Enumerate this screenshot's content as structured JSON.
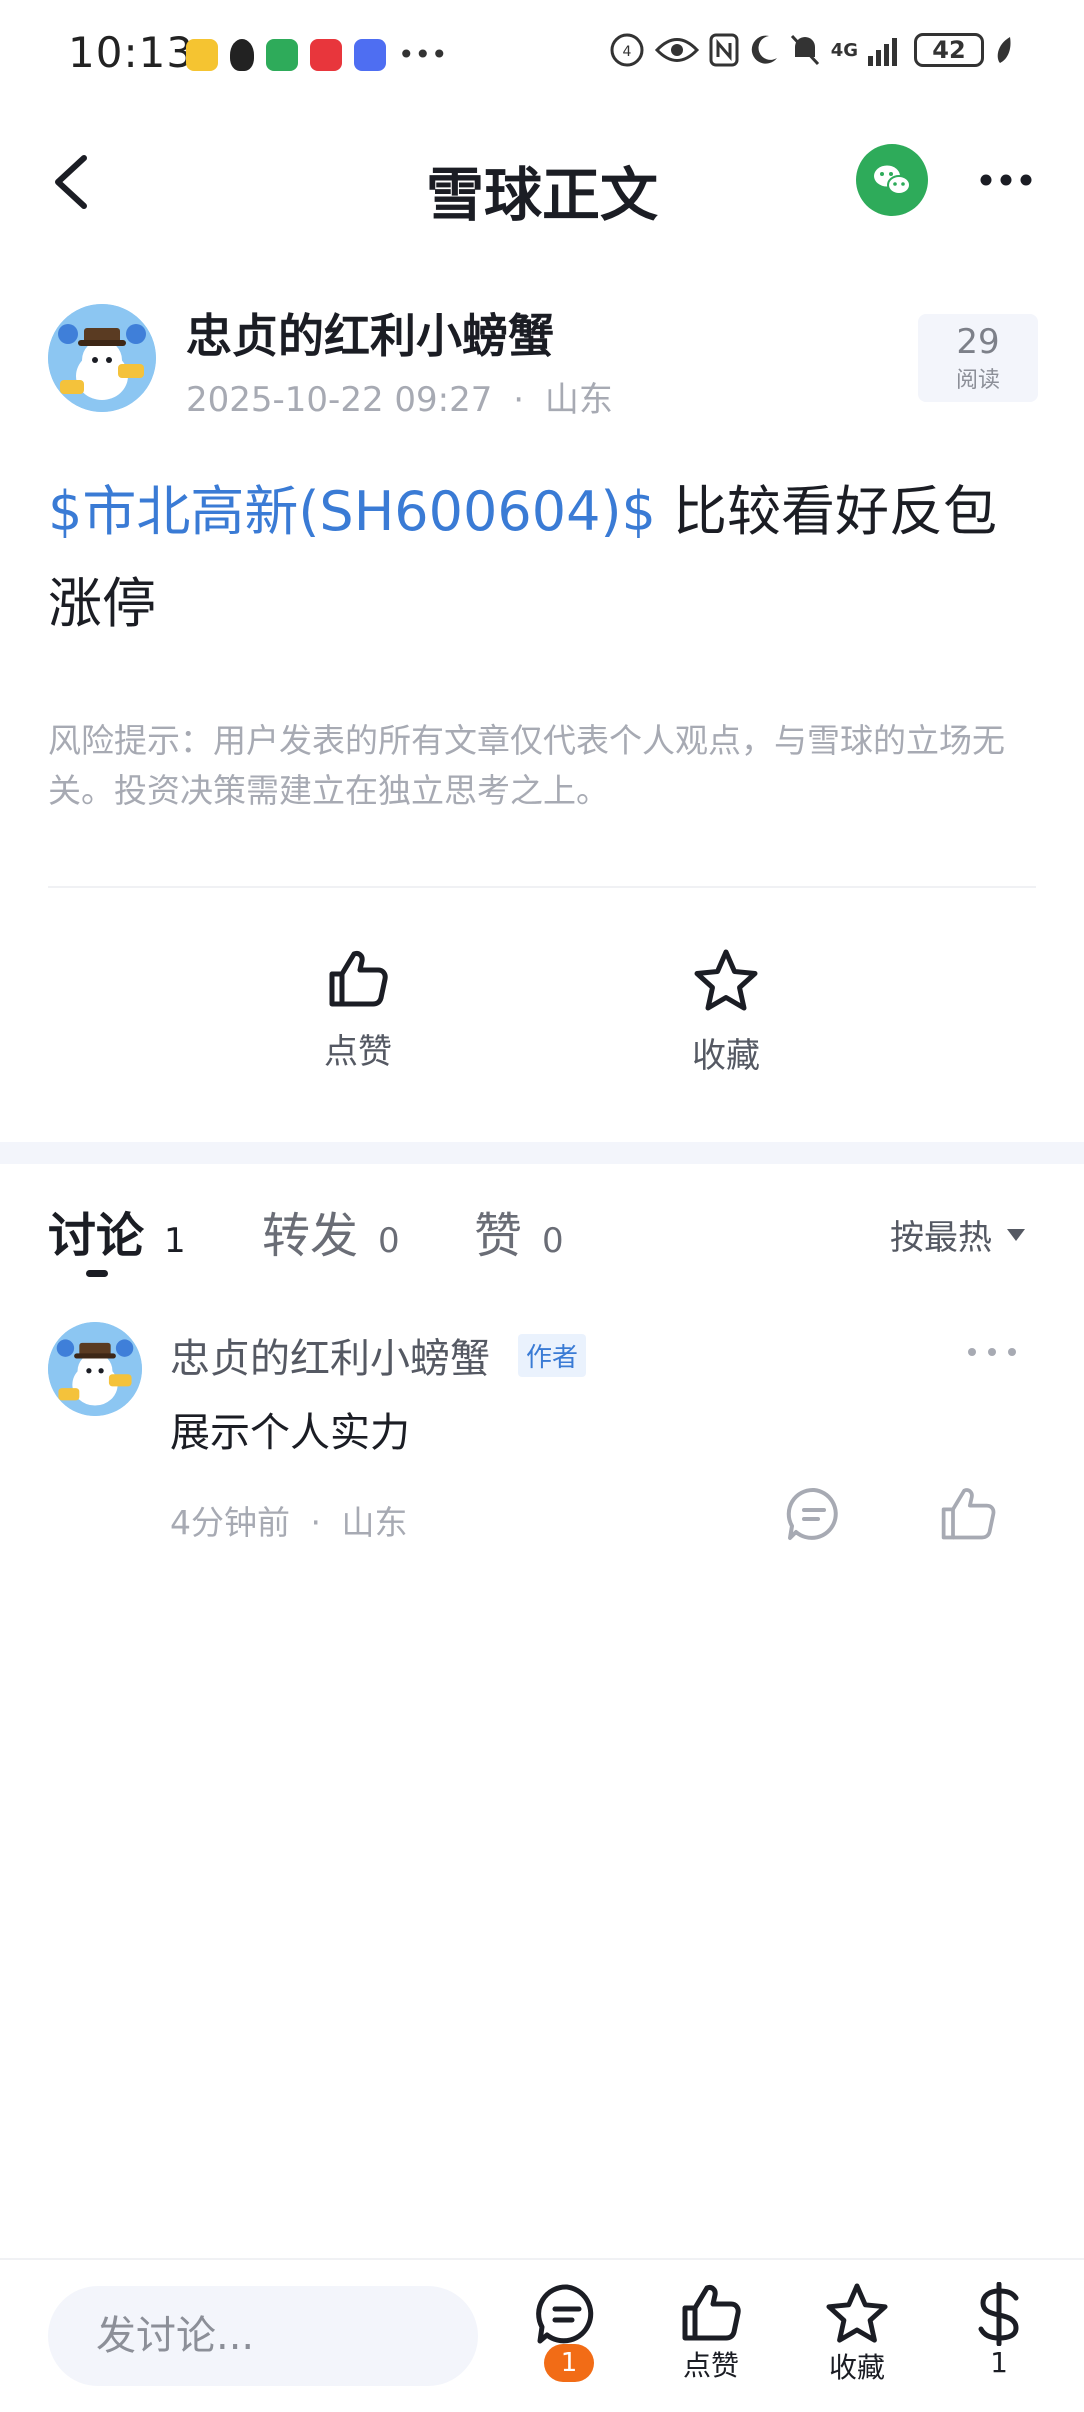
{
  "status_bar": {
    "time": "10:13",
    "battery": "42",
    "network": "4G"
  },
  "nav": {
    "title": "雪球正文"
  },
  "post": {
    "author_name": "忠贞的红利小螃蟹",
    "timestamp": "2025-10-22 09:27",
    "location": "山东",
    "meta_separator": "·",
    "read_count": "29",
    "read_label": "阅读",
    "stock_tag": "$市北高新(SH600604)$",
    "body_text": " 比较看好反包涨停",
    "risk_notice": "风险提示：用户发表的所有文章仅代表个人观点，与雪球的立场无关。投资决策需建立在独立思考之上。",
    "like_label": "点赞",
    "favorite_label": "收藏"
  },
  "tabs": [
    {
      "label": "讨论",
      "count": "1"
    },
    {
      "label": "转发",
      "count": "0"
    },
    {
      "label": "赞",
      "count": "0"
    }
  ],
  "sort_label": "按最热",
  "comment": {
    "author": "忠贞的红利小螃蟹",
    "badge": "作者",
    "text": "展示个人实力",
    "time": "4分钟前",
    "location": "山东",
    "meta_separator": "·"
  },
  "bottom_bar": {
    "input_placeholder": "发讨论...",
    "comment_badge": "1",
    "like_label": "点赞",
    "favorite_label": "收藏",
    "reward_count": "1"
  },
  "colors": {
    "accent_link": "#3a7bd5",
    "wechat_green": "#2eab5a",
    "badge_orange": "#f26c16"
  }
}
